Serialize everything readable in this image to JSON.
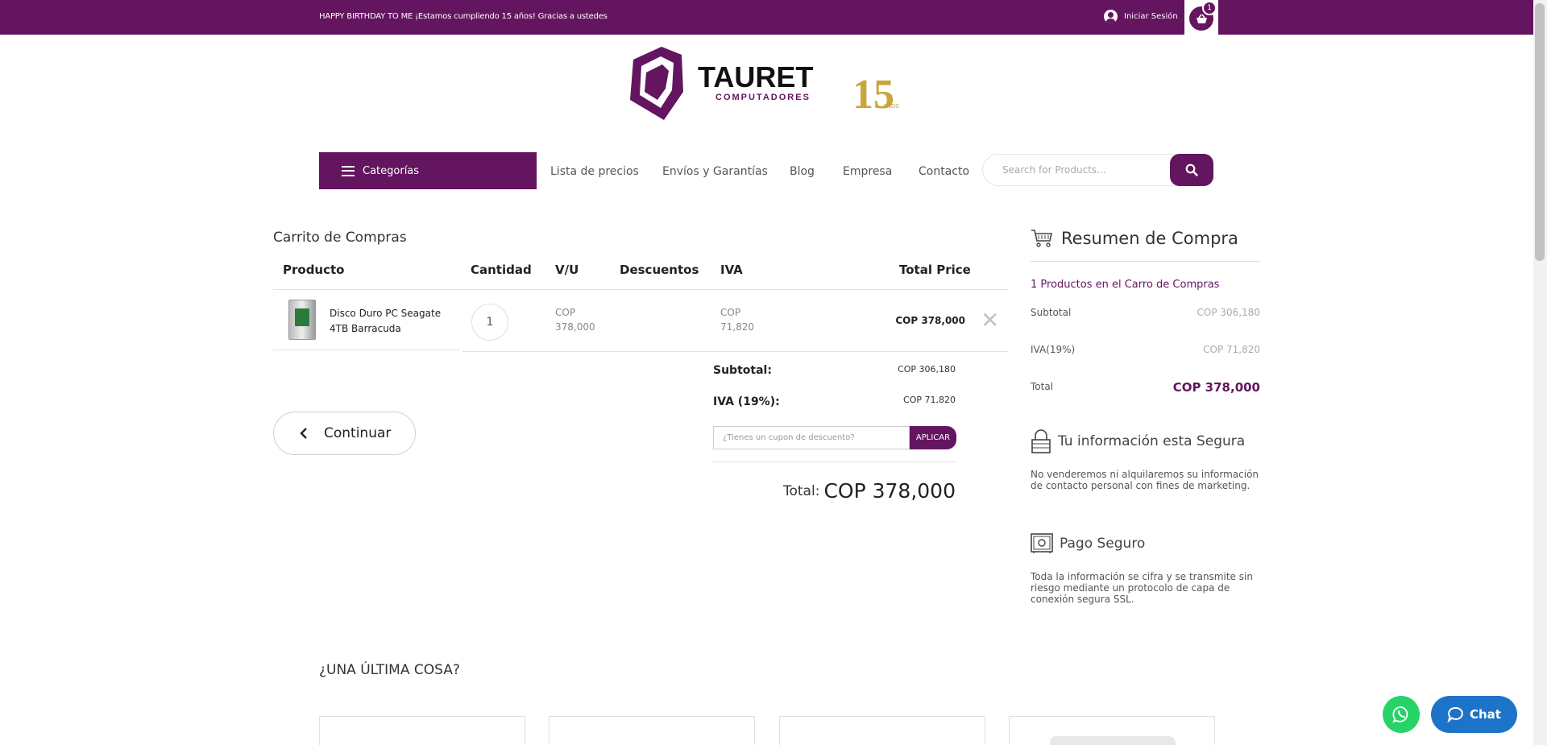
{
  "topbar": {
    "promo": "HAPPY BIRTHDAY TO ME ¡Estamos cumpliendo 15 años! Gracias a ustedes",
    "login": "Iniciar Sesión",
    "cart_count": "1"
  },
  "logo": {
    "brand": "TAURET",
    "subtitle": "COMPUTADORES",
    "anniversary": "15",
    "anniversary_small": "AÑOS"
  },
  "nav": {
    "categories": "Categorías",
    "items": [
      "Lista de precios",
      "Envíos y Garantías",
      "Blog",
      "Empresa",
      "Contacto"
    ],
    "search_placeholder": "Search for Products..."
  },
  "cart": {
    "title": "Carrito de Compras",
    "columns": [
      "Producto",
      "Cantidad",
      "V/U",
      "Descuentos",
      "IVA",
      "Total Price"
    ],
    "items": [
      {
        "name": "Disco Duro PC Seagate 4TB Barracuda",
        "quantity": "1",
        "unit_currency": "COP",
        "unit_value": "378,000",
        "iva_currency": "COP",
        "iva_value": "71,820",
        "total": "COP 378,000"
      }
    ],
    "subtotal_label": "Subtotal:",
    "subtotal_value": "COP 306,180",
    "iva_label": "IVA (19%):",
    "iva_value": "COP 71,820",
    "coupon_placeholder": "¿Tienes un cupon de descuento?",
    "coupon_button": "APLICAR",
    "total_label": "Total:",
    "total_value": "COP 378,000",
    "continue_button": "Continuar"
  },
  "summary": {
    "title": "Resumen de Compra",
    "count_text": "1 Productos en el Carro de Compras",
    "subtotal_label": "Subtotal",
    "subtotal_value": "COP 306,180",
    "iva_label": "IVA(19%)",
    "iva_value": "COP 71,820",
    "total_label": "Total",
    "total_value": "COP 378,000",
    "secure_title": "Tu información esta Segura",
    "secure_text": "No venderemos ni alquilaremos su información de contacto personal con fines de marketing.",
    "payment_title": "Pago Seguro",
    "payment_text": "Toda la información se cifra y se transmite sin riesgo mediante un protocolo de capa de conexión segura SSL."
  },
  "upsell": {
    "title": "¿UNA ÚLTIMA COSA?"
  },
  "chat": {
    "label": "Chat"
  },
  "colors": {
    "brand": "#64155f",
    "gold": "#c9a53a",
    "whatsapp": "#25d366",
    "chat": "#1d73c8"
  }
}
